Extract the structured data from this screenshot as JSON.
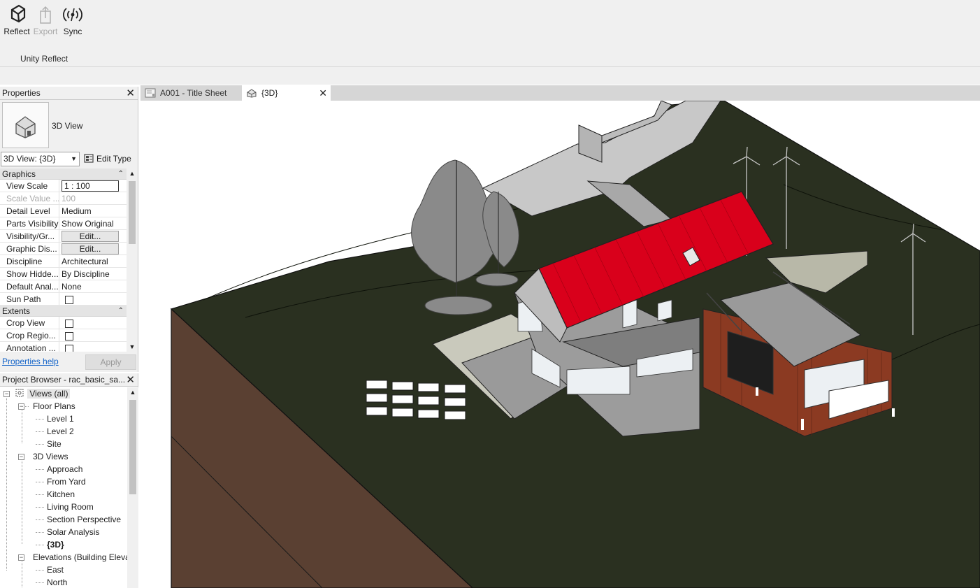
{
  "ribbon": {
    "buttons": [
      {
        "label": "Reflect",
        "icon": "unity-logo-icon",
        "enabled": true
      },
      {
        "label": "Export",
        "icon": "export-icon",
        "enabled": false
      },
      {
        "label": "Sync",
        "icon": "sync-broadcast-icon",
        "enabled": true
      }
    ],
    "panel_label": "Unity Reflect"
  },
  "properties": {
    "title": "Properties",
    "type_name": "3D View",
    "type_selector": "3D View: {3D}",
    "edit_type_label": "Edit Type",
    "categories": [
      {
        "name": "Graphics",
        "rows": [
          {
            "name": "View Scale",
            "value": "1 : 100",
            "kind": "input"
          },
          {
            "name": "Scale Value ...",
            "value": "100",
            "kind": "dim"
          },
          {
            "name": "Detail Level",
            "value": "Medium",
            "kind": "text"
          },
          {
            "name": "Parts Visibility",
            "value": "Show Original",
            "kind": "text"
          },
          {
            "name": "Visibility/Gr...",
            "value": "Edit...",
            "kind": "button"
          },
          {
            "name": "Graphic Dis...",
            "value": "Edit...",
            "kind": "button"
          },
          {
            "name": "Discipline",
            "value": "Architectural",
            "kind": "text"
          },
          {
            "name": "Show Hidde...",
            "value": "By Discipline",
            "kind": "text"
          },
          {
            "name": "Default Anal...",
            "value": "None",
            "kind": "text"
          },
          {
            "name": "Sun Path",
            "value": "",
            "kind": "checkbox"
          }
        ]
      },
      {
        "name": "Extents",
        "rows": [
          {
            "name": "Crop View",
            "value": "",
            "kind": "checkbox"
          },
          {
            "name": "Crop Regio...",
            "value": "",
            "kind": "checkbox"
          },
          {
            "name": "Annotation ...",
            "value": "",
            "kind": "checkbox"
          }
        ]
      }
    ],
    "help_link": "Properties help",
    "apply_label": "Apply"
  },
  "browser": {
    "title": "Project Browser - rac_basic_sa...",
    "root": "Views (all)",
    "groups": [
      {
        "label": "Floor Plans",
        "items": [
          "Level 1",
          "Level 2",
          "Site"
        ]
      },
      {
        "label": "3D Views",
        "items": [
          "Approach",
          "From Yard",
          "Kitchen",
          "Living Room",
          "Section Perspective",
          "Solar Analysis",
          "{3D}"
        ]
      },
      {
        "label": "Elevations (Building Eleva",
        "items": [
          "East",
          "North"
        ]
      }
    ],
    "active_item": "{3D}"
  },
  "tabs": [
    {
      "label": "A001 - Title Sheet",
      "icon": "sheet-icon",
      "active": false
    },
    {
      "label": "{3D}",
      "icon": "3d-house-icon",
      "active": true
    }
  ],
  "colors": {
    "roof": "#d9001b",
    "terrain": "#2a3020",
    "soil": "#5a4032",
    "cladding": "#8b3a22"
  }
}
